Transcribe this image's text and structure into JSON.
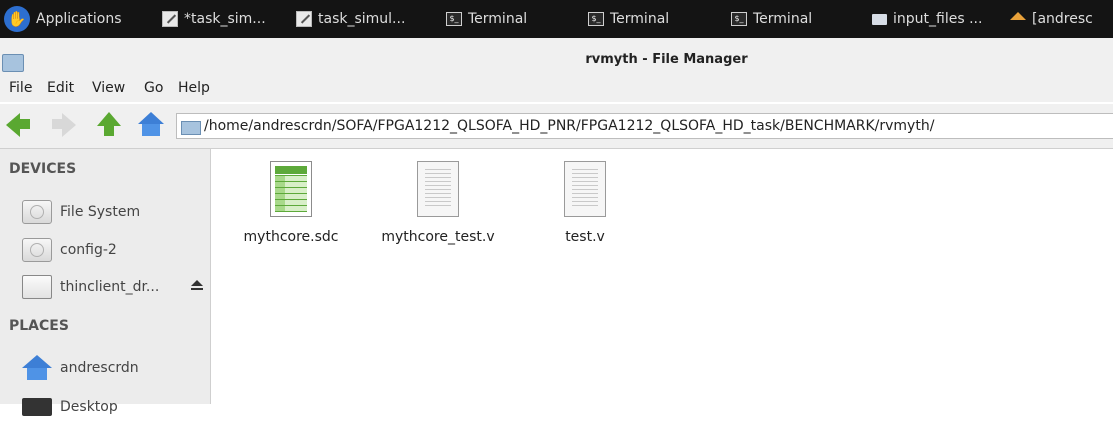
{
  "panel": {
    "buttons": [
      {
        "label": "Applications",
        "icon": "xfce-mouse-icon"
      },
      {
        "label": "*task_sim...",
        "icon": "text-editor-icon"
      },
      {
        "label": "task_simul...",
        "icon": "text-editor-icon"
      },
      {
        "label": "Terminal",
        "icon": "terminal-icon"
      },
      {
        "label": "Terminal",
        "icon": "terminal-icon"
      },
      {
        "label": "Terminal",
        "icon": "terminal-icon"
      },
      {
        "label": "input_files ...",
        "icon": "folder-icon"
      },
      {
        "label": "[andresc",
        "icon": "home-icon"
      }
    ]
  },
  "window": {
    "title": "rvmyth - File Manager"
  },
  "menubar": {
    "items": [
      "File",
      "Edit",
      "View",
      "Go",
      "Help"
    ]
  },
  "toolbar": {
    "path": "/home/andrescrdn/SOFA/FPGA1212_QLSOFA_HD_PNR/FPGA1212_QLSOFA_HD_task/BENCHMARK/rvmyth/"
  },
  "sidebar": {
    "devices_heading": "DEVICES",
    "devices": [
      {
        "label": "File System",
        "icon": "drive-icon"
      },
      {
        "label": "config-2",
        "icon": "drive-icon"
      },
      {
        "label": "thinclient_dr...",
        "icon": "removable-drive-icon"
      }
    ],
    "places_heading": "PLACES",
    "places": [
      {
        "label": "andrescrdn",
        "icon": "home-folder-icon"
      },
      {
        "label": "Desktop",
        "icon": "desktop-icon"
      }
    ]
  },
  "files": [
    {
      "name": "mythcore.sdc",
      "icon": "spreadsheet-file-icon"
    },
    {
      "name": "mythcore_test.v",
      "icon": "text-file-icon"
    },
    {
      "name": "test.v",
      "icon": "text-file-icon"
    }
  ],
  "colors": {
    "panel_bg": "#141414",
    "accent_green": "#5aa831",
    "accent_blue": "#3d7fd6"
  }
}
